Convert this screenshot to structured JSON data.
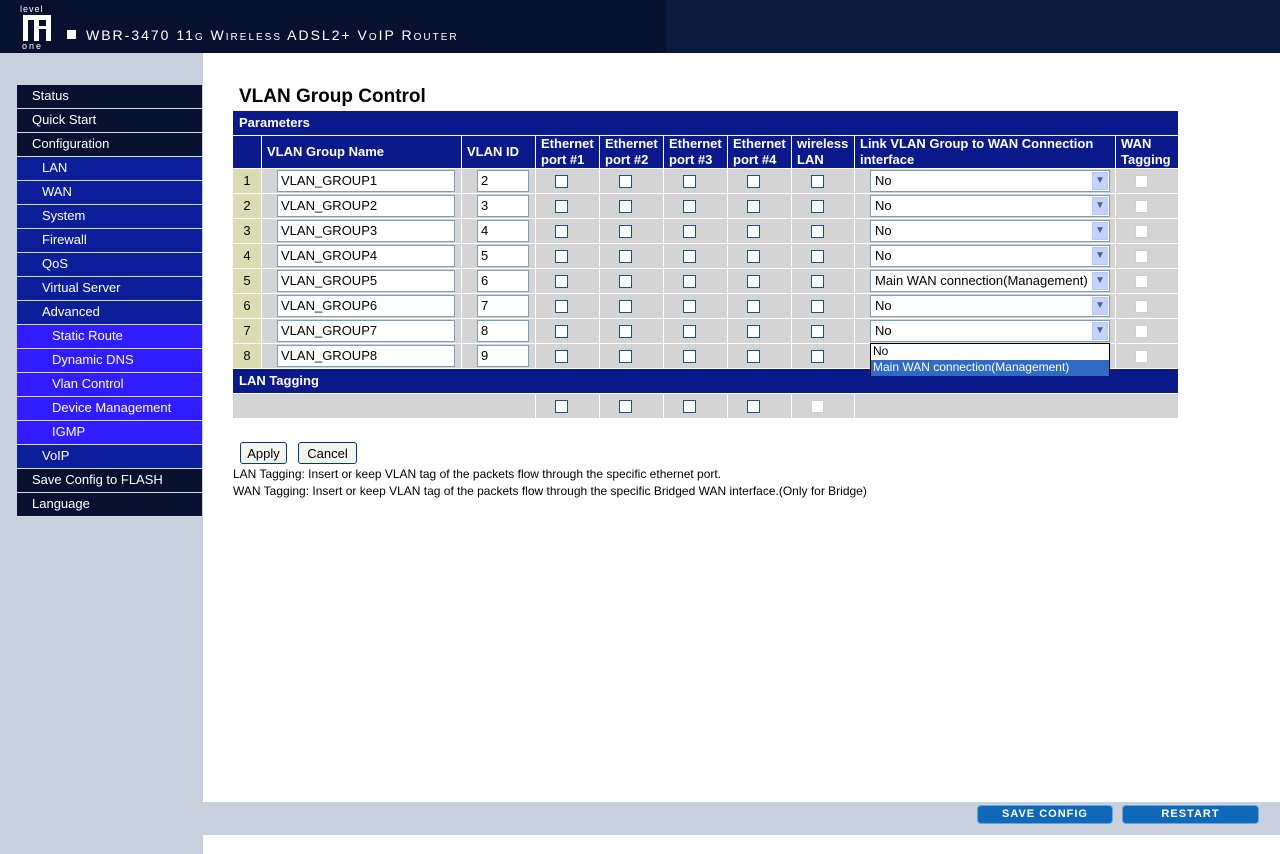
{
  "header": {
    "logo_top": "level",
    "logo_bottom": "one",
    "title": "WBR-3470 11g Wireless ADSL2+ VoIP Router"
  },
  "sidebar": {
    "items": [
      {
        "label": "Status",
        "level": 0
      },
      {
        "label": "Quick Start",
        "level": 0
      },
      {
        "label": "Configuration",
        "level": 0
      },
      {
        "label": "LAN",
        "level": 1
      },
      {
        "label": "WAN",
        "level": 1
      },
      {
        "label": "System",
        "level": 1
      },
      {
        "label": "Firewall",
        "level": 1
      },
      {
        "label": "QoS",
        "level": 1
      },
      {
        "label": "Virtual Server",
        "level": 1
      },
      {
        "label": "Advanced",
        "level": 1
      },
      {
        "label": "Static Route",
        "level": 2
      },
      {
        "label": "Dynamic DNS",
        "level": 2
      },
      {
        "label": "Vlan Control",
        "level": 2
      },
      {
        "label": "Device Management",
        "level": 2
      },
      {
        "label": "IGMP",
        "level": 2
      },
      {
        "label": "VoIP",
        "level": 1
      },
      {
        "label": "Save Config to FLASH",
        "level": 0
      },
      {
        "label": "Language",
        "level": 0
      }
    ]
  },
  "page": {
    "title": "VLAN Group Control",
    "parameters_label": "Parameters",
    "lan_tagging_label": "LAN Tagging"
  },
  "table": {
    "headers": {
      "name": "VLAN Group Name",
      "vlan_id": "VLAN ID",
      "eth1": "Ethernet port #1",
      "eth2": "Ethernet port #2",
      "eth3": "Ethernet port #3",
      "eth4": "Ethernet port #4",
      "wlan": "wireless LAN",
      "link": "Link VLAN Group to WAN Connection interface",
      "wan_tag": "WAN Tagging"
    },
    "rows": [
      {
        "num": "1",
        "name": "VLAN_GROUP1",
        "vlan_id": "2",
        "link": "No"
      },
      {
        "num": "2",
        "name": "VLAN_GROUP2",
        "vlan_id": "3",
        "link": "No"
      },
      {
        "num": "3",
        "name": "VLAN_GROUP3",
        "vlan_id": "4",
        "link": "No"
      },
      {
        "num": "4",
        "name": "VLAN_GROUP4",
        "vlan_id": "5",
        "link": "No"
      },
      {
        "num": "5",
        "name": "VLAN_GROUP5",
        "vlan_id": "6",
        "link": "Main WAN connection(Management)"
      },
      {
        "num": "6",
        "name": "VLAN_GROUP6",
        "vlan_id": "7",
        "link": "No"
      },
      {
        "num": "7",
        "name": "VLAN_GROUP7",
        "vlan_id": "8",
        "link": "No"
      },
      {
        "num": "8",
        "name": "VLAN_GROUP8",
        "vlan_id": "9",
        "link": ""
      }
    ],
    "dropdown_options": [
      "No",
      "Main WAN connection(Management)"
    ],
    "dropdown_highlighted": "Main WAN connection(Management)"
  },
  "buttons": {
    "apply": "Apply",
    "cancel": "Cancel",
    "save_config": "SAVE CONFIG",
    "restart": "RESTART"
  },
  "notes": {
    "lan": "LAN Tagging: Insert or keep VLAN tag of the packets flow through the specific ethernet port.",
    "wan": "WAN Tagging: Insert or keep VLAN tag of the packets flow through the specific Bridged WAN interface.(Only for Bridge)"
  },
  "icons": {
    "select_arrow": "chevron-down-icon"
  }
}
